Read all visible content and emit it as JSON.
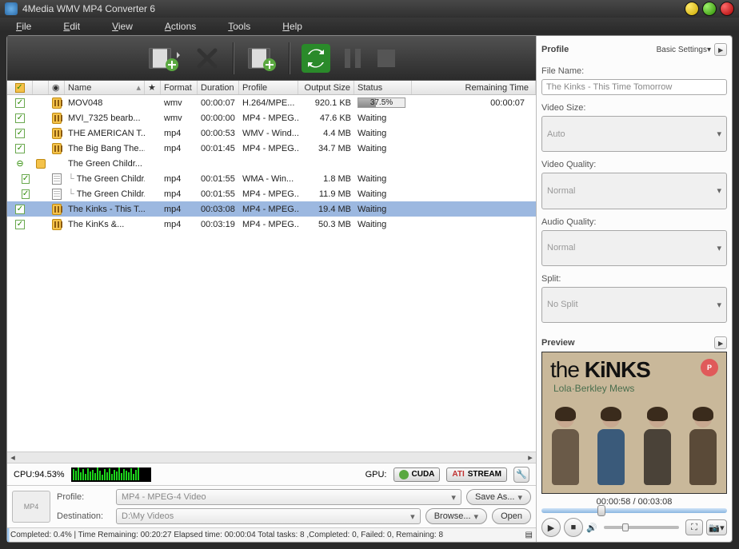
{
  "titlebar": {
    "title": "4Media WMV MP4 Converter 6"
  },
  "menu": {
    "file": "File",
    "edit": "Edit",
    "view": "View",
    "actions": "Actions",
    "tools": "Tools",
    "help": "Help"
  },
  "columns": {
    "name": "Name",
    "format": "Format",
    "duration": "Duration",
    "profile": "Profile",
    "output": "Output Size",
    "status": "Status",
    "remaining": "Remaining Time"
  },
  "rows": [
    {
      "indent": 0,
      "icon": "file",
      "name": "MOV048",
      "format": "wmv",
      "duration": "00:00:07",
      "profile": "H.264/MPE...",
      "output": "920.1 KB",
      "status_type": "progress",
      "progress": "37.5%",
      "progress_w": "37.5%",
      "remaining": "00:00:07",
      "checked": true
    },
    {
      "indent": 0,
      "icon": "file",
      "name": "MVI_7325 bearb...",
      "format": "wmv",
      "duration": "00:00:00",
      "profile": "MP4 - MPEG...",
      "output": "47.6 KB",
      "status_type": "text",
      "status": "Waiting",
      "checked": true
    },
    {
      "indent": 0,
      "icon": "file",
      "name": "THE AMERICAN T...",
      "format": "mp4",
      "duration": "00:00:53",
      "profile": "WMV - Wind...",
      "output": "4.4 MB",
      "status_type": "text",
      "status": "Waiting",
      "checked": true
    },
    {
      "indent": 0,
      "icon": "file",
      "name": "The Big Bang The...",
      "format": "mp4",
      "duration": "00:01:45",
      "profile": "MP4 - MPEG...",
      "output": "34.7 MB",
      "status_type": "text",
      "status": "Waiting",
      "checked": true
    },
    {
      "indent": 0,
      "icon": "folder",
      "name": "The Green Childr...",
      "format": "",
      "duration": "",
      "profile": "",
      "output": "",
      "status_type": "none",
      "checked": null
    },
    {
      "indent": 1,
      "icon": "doc",
      "name": "The Green Childr...",
      "format": "mp4",
      "duration": "00:01:55",
      "profile": "WMA - Win...",
      "output": "1.8 MB",
      "status_type": "text",
      "status": "Waiting",
      "checked": true
    },
    {
      "indent": 1,
      "icon": "doc",
      "name": "The Green Childr...",
      "format": "mp4",
      "duration": "00:01:55",
      "profile": "MP4 - MPEG...",
      "output": "11.9 MB",
      "status_type": "text",
      "status": "Waiting",
      "checked": true
    },
    {
      "indent": 0,
      "icon": "file",
      "name": "The Kinks - This T...",
      "format": "mp4",
      "duration": "00:03:08",
      "profile": "MP4 - MPEG...",
      "output": "19.4 MB",
      "status_type": "text",
      "status": "Waiting",
      "checked": true,
      "selected": true
    },
    {
      "indent": 0,
      "icon": "file",
      "name": "The KinKs &amp;...",
      "format": "mp4",
      "duration": "00:03:19",
      "profile": "MP4 - MPEG...",
      "output": "50.3 MB",
      "status_type": "text",
      "status": "Waiting",
      "checked": true
    }
  ],
  "cpu": {
    "label": "CPU:94.53%",
    "gpu_label": "GPU:",
    "cuda": "CUDA",
    "ati": "STREAM"
  },
  "bottom": {
    "profile_label": "Profile:",
    "profile_value": "MP4 - MPEG-4 Video",
    "saveas": "Save As...",
    "dest_label": "Destination:",
    "dest_value": "D:\\My Videos",
    "browse": "Browse...",
    "open": "Open"
  },
  "status": "Completed: 0.4% | Time Remaining: 00:20:27 Elapsed time: 00:00:04 Total tasks: 8 ,Completed: 0, Failed: 0, Remaining: 8",
  "profile_panel": {
    "title": "Profile",
    "basic": "Basic Settings",
    "filename_label": "File Name:",
    "filename": "The Kinks - This Time Tomorrow",
    "videosize_label": "Video Size:",
    "videosize": "Auto",
    "vq_label": "Video Quality:",
    "vq": "Normal",
    "aq_label": "Audio Quality:",
    "aq": "Normal",
    "split_label": "Split:",
    "split": "No Split"
  },
  "preview": {
    "title": "Preview",
    "logo1": "the",
    "logo2": "KiNKS",
    "sub": "Lola·Berkley Mews",
    "time": "00:00:58 / 00:03:08"
  }
}
